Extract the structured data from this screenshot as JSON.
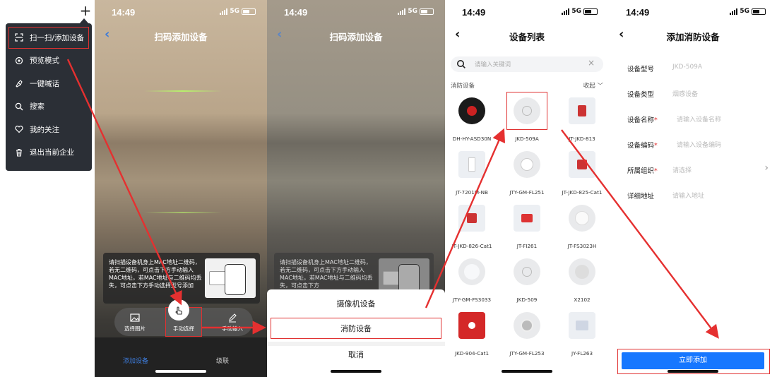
{
  "menu": {
    "items": [
      {
        "label": "扫一扫/添加设备",
        "icon": "scan-icon"
      },
      {
        "label": "预览模式",
        "icon": "preview-icon"
      },
      {
        "label": "一键喊话",
        "icon": "megaphone-icon"
      },
      {
        "label": "搜索",
        "icon": "search-icon"
      },
      {
        "label": "我的关注",
        "icon": "heart-icon"
      },
      {
        "label": "退出当前企业",
        "icon": "trash-icon"
      }
    ]
  },
  "status_bar": {
    "time": "14:49",
    "network": "5G"
  },
  "scan_screen": {
    "title": "扫码添加设备",
    "tip": "请扫描设备机身上MAC地址二维码，若无二维码，可点击下方手动输入MAC地址，若MAC地址与二维码均丢失，可点击下方手动选择型号添加",
    "actions": {
      "pick_image": "选择图片",
      "manual_select": "手动选择",
      "manual_input": "手动输入"
    },
    "tabs": {
      "add_device": "添加设备",
      "cascade": "级联"
    }
  },
  "action_sheet": {
    "title": "扫码添加设备",
    "tip": "请扫描设备机身上MAC地址二维码，若无二维码，可点击下方手动输入MAC地址，若MAC地址与二维码均丢失，可点击下方",
    "items": [
      "摄像机设备",
      "消防设备"
    ],
    "cancel": "取消"
  },
  "device_list": {
    "title": "设备列表",
    "search_placeholder": "请输入关键词",
    "category": "消防设备",
    "collapse": "收起",
    "devices": [
      "DH-HY-ASD30N",
      "JKD-509A",
      "JT-JKD-813",
      "JT-7201M-NB",
      "JTY-GM-FL251",
      "JT-JKD-825-Cat1",
      "JT-JKD-826-Cat1",
      "JT-FI261",
      "JT-FS3023H",
      "JTY-GM-FS3033",
      "JKD-509",
      "X2102",
      "JKD-904-Cat1",
      "JTY-GM-FL253",
      "JY-FL263"
    ]
  },
  "add_form": {
    "title": "添加消防设备",
    "fields": [
      {
        "label": "设备型号",
        "required": "",
        "value": "JKD-509A"
      },
      {
        "label": "设备类型",
        "required": "",
        "value": "烟感设备"
      },
      {
        "label": "设备名称",
        "required": "*",
        "value": "请输入设备名称"
      },
      {
        "label": "设备编码",
        "required": "*",
        "value": "请输入设备编码"
      },
      {
        "label": "所属组织",
        "required": "*",
        "value": "请选择"
      },
      {
        "label": "详细地址",
        "required": "",
        "value": "请输入地址"
      }
    ],
    "submit": "立即添加"
  },
  "colors": {
    "accent": "#1677ff",
    "highlight": "#e03131",
    "menu_bg": "#2b2f36"
  }
}
